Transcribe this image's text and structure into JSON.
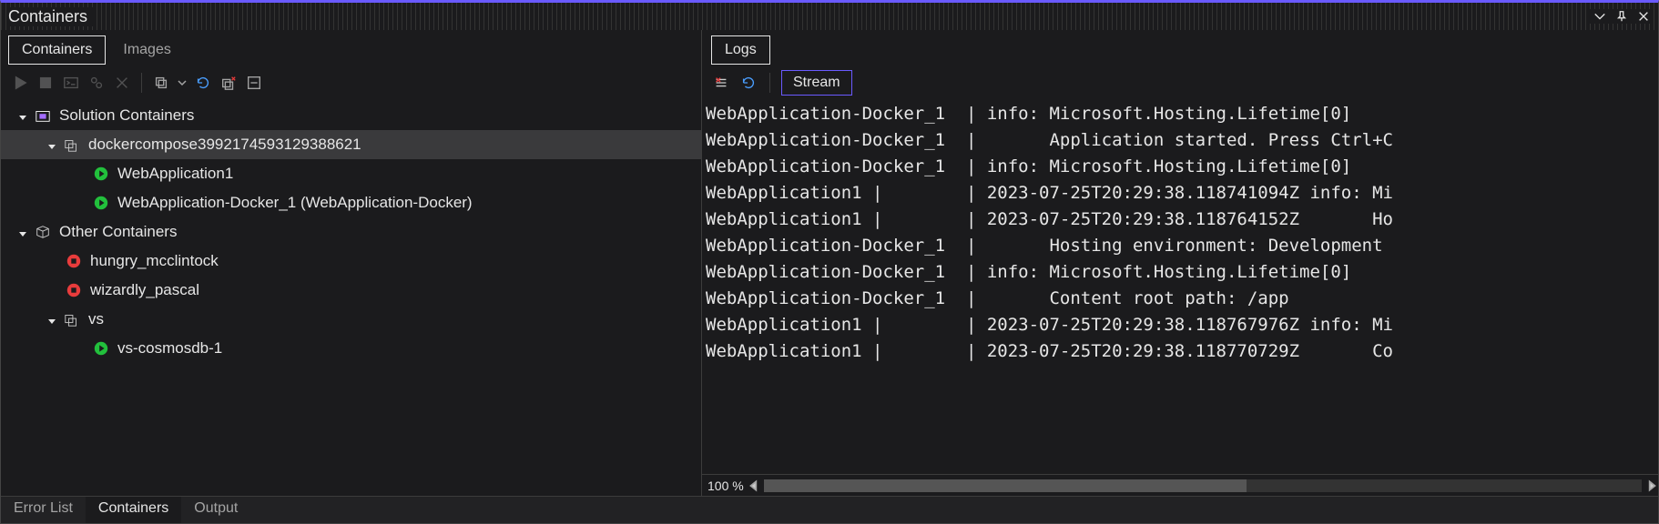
{
  "panelTitle": "Containers",
  "topTabs": [
    {
      "label": "Containers",
      "active": true
    },
    {
      "label": "Images",
      "active": false
    }
  ],
  "tree": {
    "solutionLabel": "Solution Containers",
    "composeLabel": "dockercompose3992174593129388621",
    "app1": "WebApplication1",
    "app2": "WebApplication-Docker_1 (WebApplication-Docker)",
    "otherLabel": "Other Containers",
    "other1": "hungry_mcclintock",
    "other2": "wizardly_pascal",
    "vsLabel": "vs",
    "vs1": "vs-cosmosdb-1"
  },
  "rightTabs": [
    {
      "label": "Logs",
      "active": true
    }
  ],
  "streamLabel": "Stream",
  "zoomLabel": "100 %",
  "logLines": [
    "WebApplication-Docker_1  | info: Microsoft.Hosting.Lifetime[0]",
    "WebApplication-Docker_1  |       Application started. Press Ctrl+C",
    "WebApplication-Docker_1  | info: Microsoft.Hosting.Lifetime[0]",
    "WebApplication1 |        | 2023-07-25T20:29:38.118741094Z info: Mi",
    "WebApplication1 |        | 2023-07-25T20:29:38.118764152Z       Ho",
    "WebApplication-Docker_1  |       Hosting environment: Development",
    "WebApplication-Docker_1  | info: Microsoft.Hosting.Lifetime[0]",
    "WebApplication-Docker_1  |       Content root path: /app",
    "WebApplication1 |        | 2023-07-25T20:29:38.118767976Z info: Mi",
    "WebApplication1 |        | 2023-07-25T20:29:38.118770729Z       Co"
  ],
  "bottomTabs": [
    {
      "label": "Error List",
      "active": false
    },
    {
      "label": "Containers",
      "active": true
    },
    {
      "label": "Output",
      "active": false
    }
  ]
}
